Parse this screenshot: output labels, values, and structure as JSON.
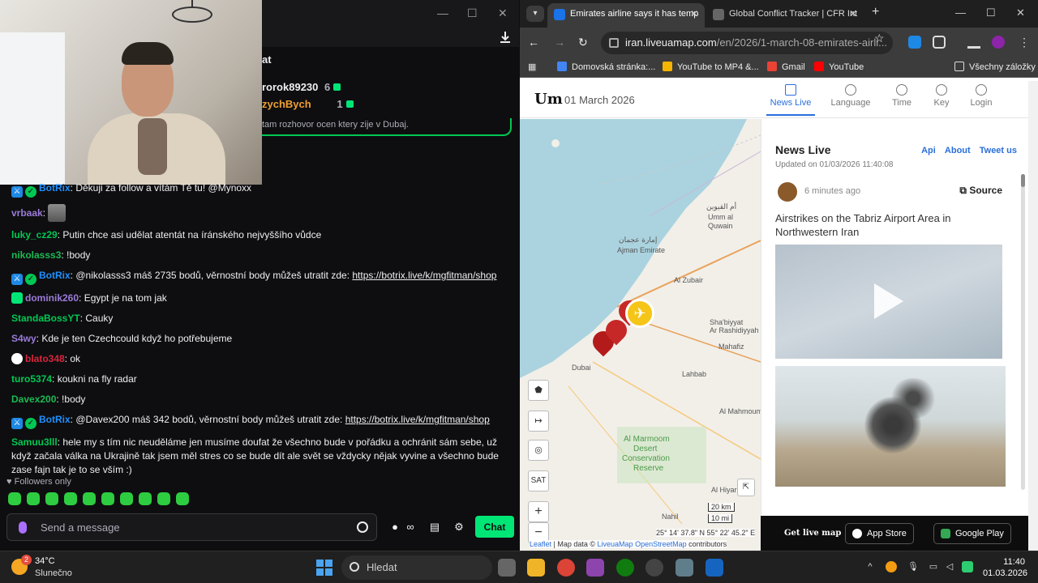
{
  "chat": {
    "leaderboard": [
      {
        "user": "rorok89230",
        "count": "6"
      },
      {
        "user": "zychBych",
        "count": "1"
      }
    ],
    "title_partial": "at",
    "pinned_partial": "tam rozhovor ocen ktery zije v Dubaj.",
    "messages": [
      {
        "user": "BotRix",
        "color": "#1e90ff",
        "badges": [
          "mod",
          "verified"
        ],
        "text": ": Děkuji za follow a vítám Tě tu! @Mynoxx"
      },
      {
        "user": "vrbaak",
        "color": "#9b7bd8",
        "badges": [],
        "text": ": ",
        "avatar": true
      },
      {
        "user": "luky_cz29",
        "color": "#00c853",
        "badges": [],
        "text": ": Putin chce asi udělat atentát na íránského nejvyššího vůdce"
      },
      {
        "user": "nikolasss3",
        "color": "#1db954",
        "badges": [],
        "text": ": !body"
      },
      {
        "user": "BotRix",
        "color": "#1e90ff",
        "badges": [
          "mod",
          "verified"
        ],
        "text": ": @nikolasss3 máš 2735 bodů, věrnostní body můžeš utratit zde: ",
        "link": "https://botrix.live/k/mgfitman/shop"
      },
      {
        "user": "dominik260",
        "color": "#9b7bd8",
        "badges": [
          "gift"
        ],
        "text": ": Egypt je na tom jak"
      },
      {
        "user": "StandaBossYT",
        "color": "#00c853",
        "badges": [],
        "text": ": Cauky"
      },
      {
        "user": "S4wy",
        "color": "#9b7bd8",
        "badges": [],
        "text": ": Kde je ten Czechcould když ho potřebujeme"
      },
      {
        "user": "blato348",
        "color": "#d7263d",
        "badges": [
          "skull"
        ],
        "text": ": ok"
      },
      {
        "user": "turo5374",
        "color": "#00c853",
        "badges": [],
        "text": ": koukni na fly radar"
      },
      {
        "user": "Davex200",
        "color": "#1db954",
        "badges": [],
        "text": ": !body"
      },
      {
        "user": "BotRix",
        "color": "#1e90ff",
        "badges": [
          "mod",
          "verified"
        ],
        "text": ": @Davex200 máš 342 bodů, věrnostní body můžeš utratit zde: ",
        "link": "https://botrix.live/k/mgfitman/shop"
      },
      {
        "user": "Samuu3lll",
        "color": "#00c853",
        "badges": [],
        "text": ": hele my s tím nic neuděláme jen musíme doufat že všechno bude v pořádku a ochránit sám sebe, už když začala válka na Ukrajině tak jsem měl stres co se bude dít ale svět se vždycky nějak vyvine a všechno bude zase fajn tak je to se vším :)",
        "multi": true
      }
    ],
    "followers_only": "Followers only",
    "input_placeholder": "Send a message",
    "send_button": "Chat",
    "icons": [
      "gift-icon",
      "infinity-icon",
      "store-icon",
      "settings-icon"
    ]
  },
  "browser": {
    "tabs": [
      {
        "title": "Emirates airline says it has temp",
        "active": true,
        "favicon_color": "#1a73e8"
      },
      {
        "title": "Global Conflict Tracker | CFR Int",
        "active": false,
        "favicon_color": "#555"
      }
    ],
    "url_host": "iran.liveuamap.com",
    "url_path": "/en/2026/1-march-08-emirates-airli...",
    "bookmarks": [
      {
        "label": "Domovská stránka:...",
        "color": "#4285f4"
      },
      {
        "label": "YouTube to MP4 &...",
        "color": "#f4b400"
      },
      {
        "label": "Gmail",
        "color": "#ea4335"
      },
      {
        "label": "YouTube",
        "color": "#ff0000"
      }
    ],
    "all_bookmarks": "Všechny záložky"
  },
  "site": {
    "logo": "Um",
    "date": "01 March 2026",
    "nav": [
      {
        "label": "News Live",
        "active": true
      },
      {
        "label": "Language",
        "active": false
      },
      {
        "label": "Time",
        "active": false
      },
      {
        "label": "Key",
        "active": false
      },
      {
        "label": "Login",
        "active": false
      }
    ],
    "map": {
      "labels": [
        {
          "text": "أم القيوين",
          "cls": ""
        },
        {
          "text": "Umm al",
          "cls": ""
        },
        {
          "text": "Quwain",
          "cls": ""
        },
        {
          "text": "إمارة عجمان",
          "cls": ""
        },
        {
          "text": "Ajman Emirate",
          "cls": ""
        },
        {
          "text": "Al Zubair",
          "cls": ""
        },
        {
          "text": "Sha'biyyat",
          "cls": ""
        },
        {
          "text": "Ar Rashidiyyah",
          "cls": ""
        },
        {
          "text": "Mahafiz",
          "cls": ""
        },
        {
          "text": "Lahbab",
          "cls": ""
        },
        {
          "text": "Al Mahmoum",
          "cls": ""
        },
        {
          "text": "Al Marmoom",
          "cls": "green"
        },
        {
          "text": "Desert",
          "cls": "green"
        },
        {
          "text": "Conservation",
          "cls": "green"
        },
        {
          "text": "Reserve",
          "cls": "green"
        },
        {
          "text": "Al Hiyar",
          "cls": ""
        },
        {
          "text": "Nahil",
          "cls": ""
        },
        {
          "text": "Dubai",
          "cls": ""
        }
      ],
      "controls": [
        "polygon-tool",
        "measure-tool",
        "hide-tool",
        "SAT",
        "+",
        "−"
      ],
      "scale_km": "20 km",
      "scale_mi": "10 mi",
      "coords": "25° 14' 37.8\" N 55° 22' 45.2\" E",
      "attribution_leaflet": "Leaflet",
      "attribution_rest": " | Map data © ",
      "attribution_lum": "LiveuaMap",
      "attribution_osm": "OpenStreetMap",
      "attribution_end": " contributors"
    },
    "news": {
      "title": "News Live",
      "links": [
        "Api",
        "About",
        "Tweet us"
      ],
      "updated": "Updated on 01/03/2026 11:40:08",
      "item_time": "6 minutes ago",
      "source_label": "Source",
      "headline": "Airstrikes on the Tabriz Airport Area in Northwestern Iran"
    },
    "footer": {
      "get_live_map": "Get live map",
      "app_store": "App Store",
      "google_play": "Google Play"
    }
  },
  "taskbar": {
    "weather_badge": "2",
    "temperature": "34°C",
    "weather_desc": "Slunečno",
    "search_placeholder": "Hledat",
    "time": "11:40",
    "date": "01.03.2026"
  }
}
